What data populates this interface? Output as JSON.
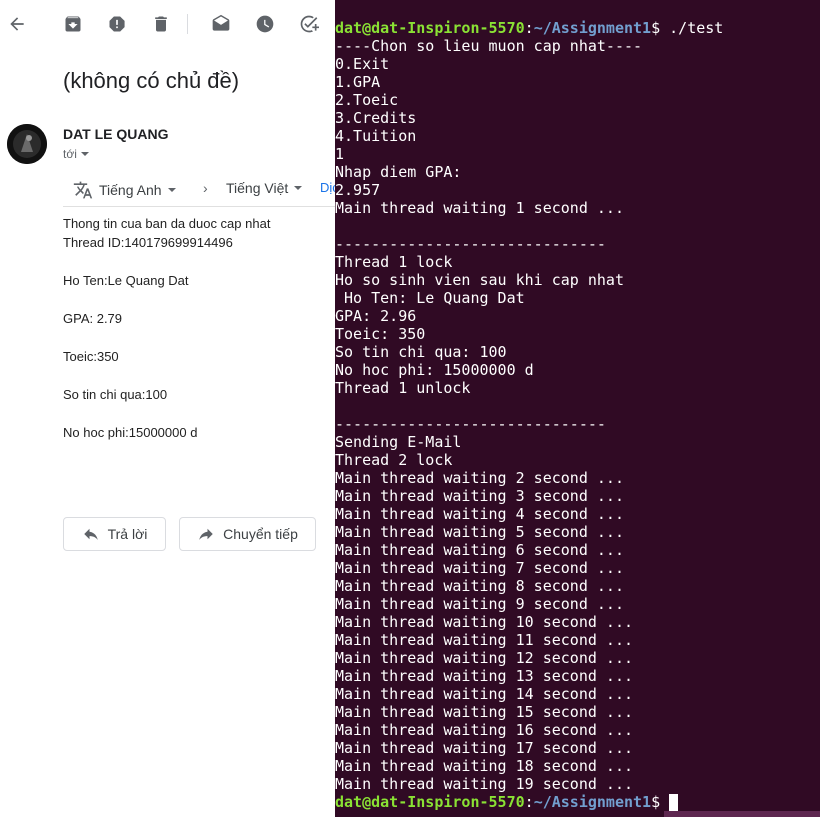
{
  "email": {
    "subject": "(không có chủ đề)",
    "sender": "DAT LE QUANG",
    "recipient": "tới",
    "translate": {
      "from_lang": "Tiếng Anh",
      "to_lang": "Tiếng Việt",
      "more": "Dịch"
    },
    "body_lines": [
      "Thong tin cua ban da duoc cap nhat",
      "Thread ID:140179699914496",
      "Ho Ten:Le Quang Dat",
      "GPA: 2.79",
      "Toeic:350",
      "So tin chi qua:100",
      "No hoc phi:15000000 d"
    ],
    "reply_label": "Trả lời",
    "forward_label": "Chuyển tiếp"
  },
  "toolbar": {
    "icons": [
      "back-icon",
      "archive-icon",
      "report-spam-icon",
      "delete-icon",
      "mark-unread-icon",
      "snooze-icon",
      "add-task-icon"
    ]
  },
  "terminal": {
    "prompt_user": "dat@dat-Inspiron-5570",
    "prompt_path": "~/Assignment1",
    "command": "./test",
    "output_lines": [
      "----Chon so lieu muon cap nhat----",
      "0.Exit",
      "1.GPA",
      "2.Toeic",
      "3.Credits",
      "4.Tuition",
      "1",
      "Nhap diem GPA:",
      "2.957",
      "Main thread waiting 1 second ...",
      "",
      "------------------------------",
      "Thread 1 lock",
      "Ho so sinh vien sau khi cap nhat",
      " Ho Ten: Le Quang Dat",
      "GPA: 2.96",
      "Toeic: 350",
      "So tin chi qua: 100",
      "No hoc phi: 15000000 d",
      "Thread 1 unlock",
      "",
      "------------------------------",
      "Sending E-Mail",
      "Thread 2 lock",
      "Main thread waiting 2 second ...",
      "Main thread waiting 3 second ...",
      "Main thread waiting 4 second ...",
      "Main thread waiting 5 second ...",
      "Main thread waiting 6 second ...",
      "Main thread waiting 7 second ...",
      "Main thread waiting 8 second ...",
      "Main thread waiting 9 second ...",
      "Main thread waiting 10 second ...",
      "Main thread waiting 11 second ...",
      "Main thread waiting 12 second ...",
      "Main thread waiting 13 second ...",
      "Main thread waiting 14 second ...",
      "Main thread waiting 15 second ...",
      "Main thread waiting 16 second ...",
      "Main thread waiting 17 second ...",
      "Main thread waiting 18 second ...",
      "Main thread waiting 19 second ..."
    ],
    "colors": {
      "background": "#300a24",
      "prompt_user": "#8ae234",
      "prompt_path": "#729fcf"
    }
  }
}
